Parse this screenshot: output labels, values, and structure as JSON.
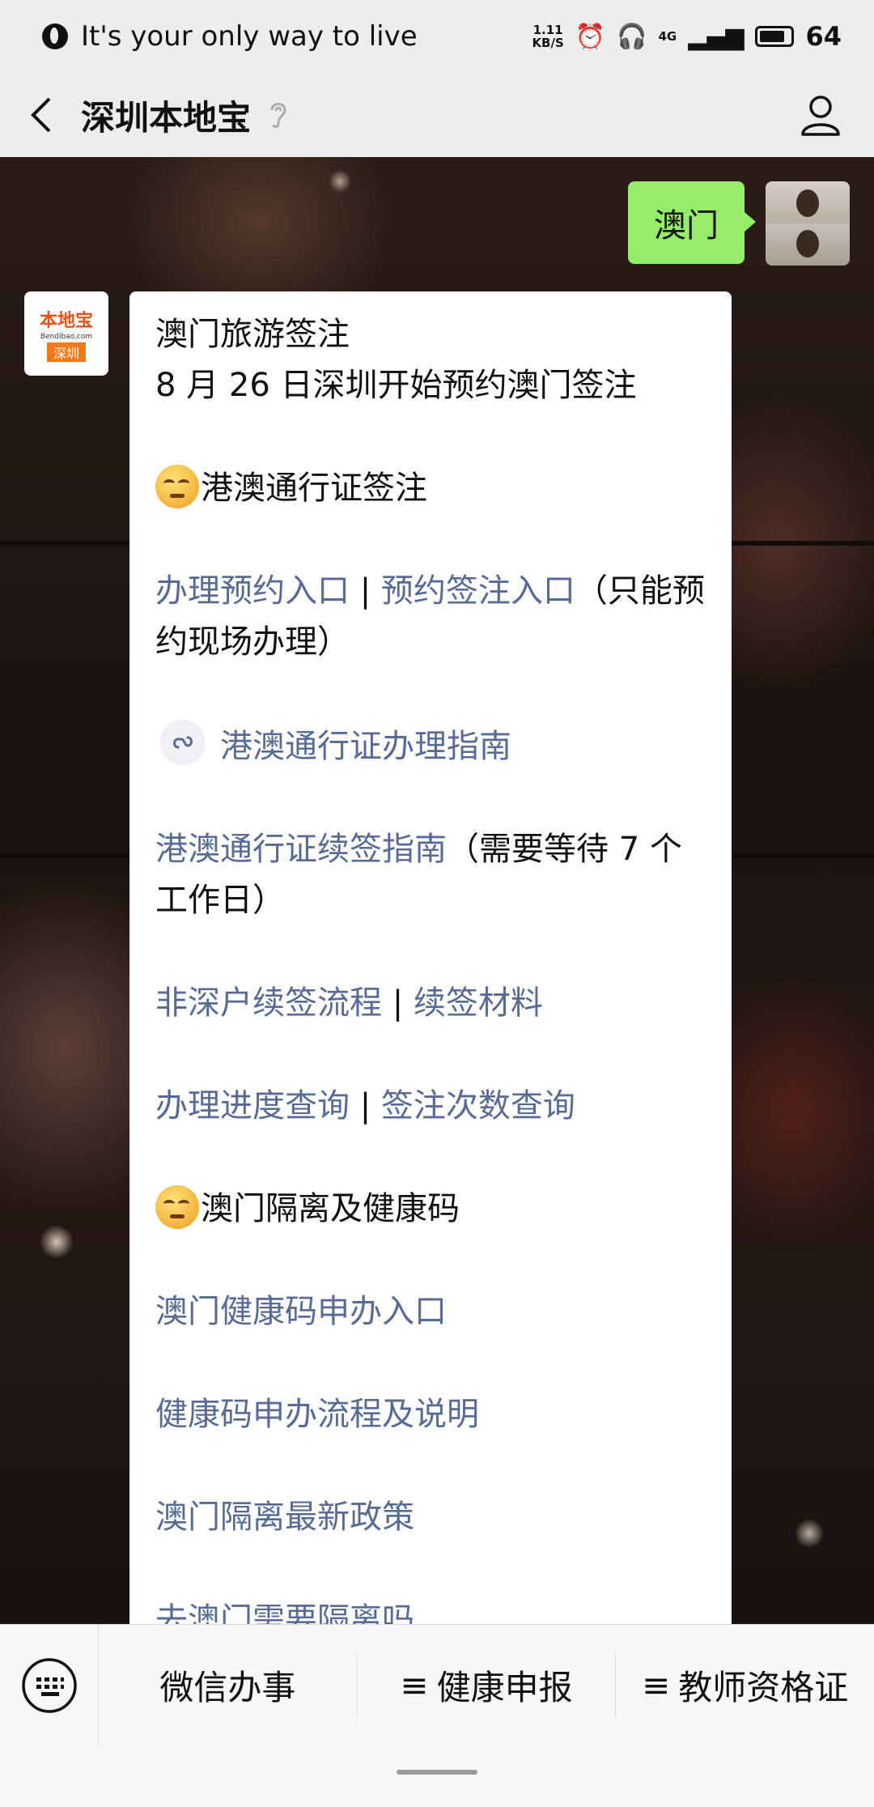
{
  "status_bar": {
    "carrier_text": "It's your only way to live",
    "speed_value": "1.11",
    "speed_unit": "KB/S",
    "network": "4G",
    "battery": "64"
  },
  "nav": {
    "title": "深圳本地宝"
  },
  "outgoing_message": {
    "text": "澳门"
  },
  "bot_avatar": {
    "logo_main": "本地宝",
    "logo_sub": "Bendibao.com",
    "logo_city": "深圳"
  },
  "incoming_message": {
    "title": "澳门旅游签注",
    "subtitle": "8 月 26 日深圳开始预约澳门签注",
    "section1_heading": "港澳通行证签注",
    "link_booking_entry": "办理预约入口",
    "separator": " | ",
    "link_visa_booking": "预约签注入口",
    "booking_note": "（只能预约现场办理）",
    "link_guide": "港澳通行证办理指南",
    "link_renew_guide": "港澳通行证续签指南",
    "renew_note": "（需要等待 7 个工作日）",
    "link_nonlocal_flow": "非深户续签流程",
    "link_renew_materials": "续签材料",
    "link_progress_query": "办理进度查询",
    "link_count_query": "签注次数查询",
    "section2_heading": "澳门隔离及健康码",
    "link_health_code_apply": "澳门健康码申办入口",
    "link_health_code_flow": "健康码申办流程及说明",
    "link_quarantine_policy": "澳门隔离最新政策",
    "link_need_quarantine": "去澳门需要隔离吗"
  },
  "bottom_menu": {
    "item1": "微信办事",
    "item2": "健康申报",
    "item3": "教师资格证",
    "menu_prefix": "≡"
  },
  "colors": {
    "bubble_out": "#95ec69",
    "link": "#576b95",
    "bar_bg": "#ededed"
  }
}
